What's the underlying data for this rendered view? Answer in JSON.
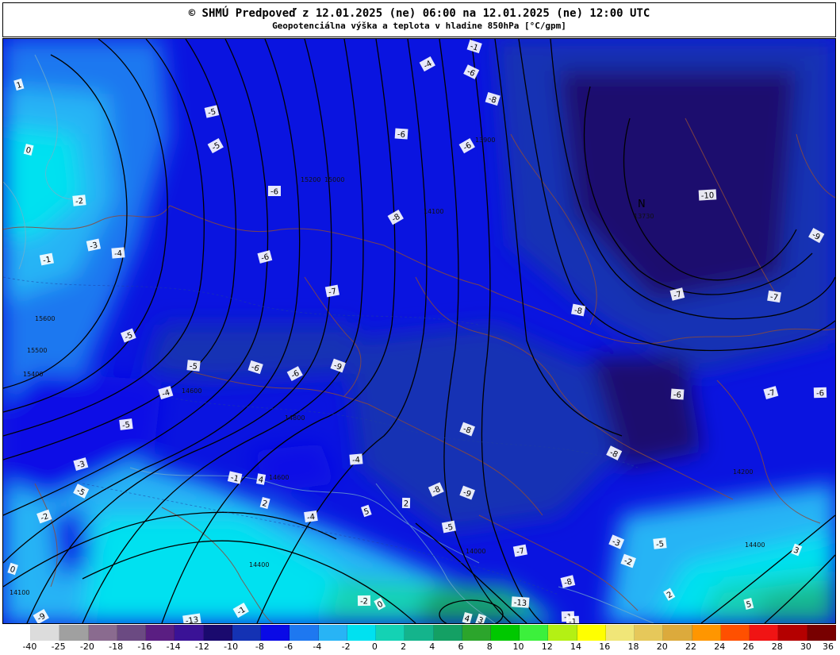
{
  "header": {
    "title": "© SHMÚ Predpoveď z 12.01.2025 (ne) 06:00 na 12.01.2025 (ne) 12:00 UTC",
    "subtitle": "Geopotenciálna výška a teplota v hladine 850hPa [°C/gpm]"
  },
  "legend": {
    "ticks": [
      "-40",
      "-25",
      "-20",
      "-18",
      "-16",
      "-14",
      "-12",
      "-10",
      "-8",
      "-6",
      "-4",
      "-2",
      "0",
      "2",
      "4",
      "6",
      "8",
      "10",
      "12",
      "14",
      "16",
      "18",
      "20",
      "22",
      "24",
      "26",
      "28",
      "30",
      "36"
    ],
    "colors": [
      "#ffffff",
      "#dcdcdc",
      "#a0a0a0",
      "#8a6b8f",
      "#6b4a82",
      "#5a1e82",
      "#3a1296",
      "#1a0a6e",
      "#1432b4",
      "#0a0ae6",
      "#1e78f0",
      "#28b4f5",
      "#00e1f0",
      "#14d2b4",
      "#14b48c",
      "#14a064",
      "#2ca52c",
      "#00c800",
      "#3cf03c",
      "#b4f014",
      "#ffff00",
      "#f0e678",
      "#e6c85a",
      "#dcaa3c",
      "#ff9600",
      "#ff5000",
      "#f01414",
      "#b40000",
      "#780000"
    ]
  },
  "map": {
    "low_center": {
      "symbol": "N",
      "value": "13730"
    },
    "height_labels": [
      "14000",
      "14100",
      "14400",
      "14600",
      "14800",
      "15000",
      "15200",
      "15400",
      "15500",
      "15600",
      "13900",
      "14200"
    ],
    "temp_labels": [
      "1",
      "0",
      "-2",
      "-3",
      "-4",
      "-1",
      "-5",
      "-6",
      "-8",
      "-7",
      "-9",
      "-10",
      "2",
      "3",
      "4",
      "5",
      "-13"
    ]
  }
}
